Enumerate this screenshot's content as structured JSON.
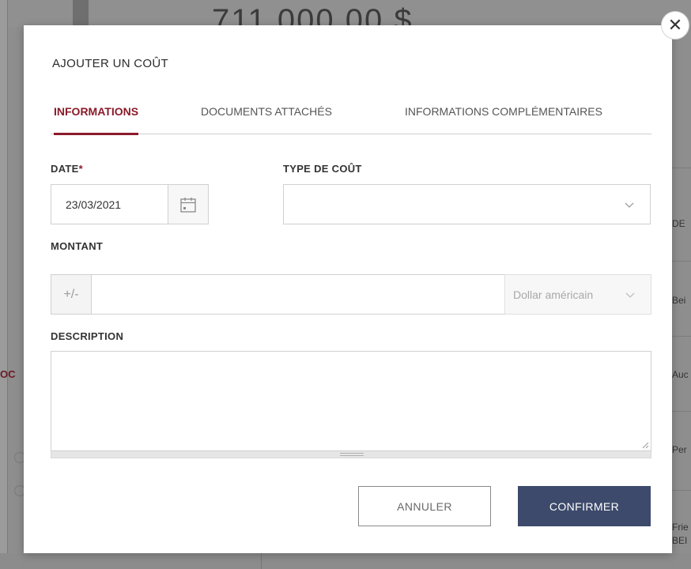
{
  "background": {
    "amount": "711 000,00 $",
    "left_label": "OC",
    "right_texts": [
      "DE",
      "Bei",
      "Auc",
      "Per",
      "Frie",
      "BEI"
    ]
  },
  "modal": {
    "title": "AJOUTER UN COÛT",
    "close_icon": "close-icon",
    "tabs": [
      {
        "label": "INFORMATIONS",
        "active": true
      },
      {
        "label": "DOCUMENTS ATTACHÉS",
        "active": false
      },
      {
        "label": "INFORMATIONS COMPLÉMENTAIRES",
        "active": false
      }
    ],
    "date": {
      "label": "DATE",
      "required_marker": "*",
      "value": "23/03/2021",
      "icon": "calendar-icon"
    },
    "cost_type": {
      "label": "TYPE DE COÛT",
      "value": "",
      "icon": "chevron-down-icon"
    },
    "amount": {
      "label": "MONTANT",
      "sign_label": "+/-",
      "value": "",
      "currency": "Dollar américain"
    },
    "description": {
      "label": "DESCRIPTION",
      "value": ""
    },
    "buttons": {
      "cancel": "ANNULER",
      "confirm": "CONFIRMER"
    }
  },
  "colors": {
    "accent": "#8b1a2a",
    "primary_button": "#3d4a6b"
  }
}
